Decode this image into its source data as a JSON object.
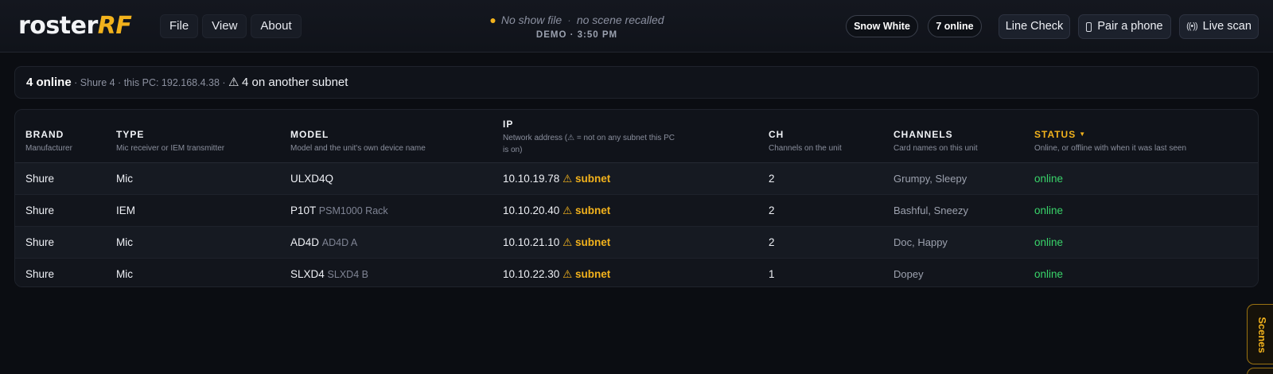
{
  "app": {
    "logo_part1": "roster",
    "logo_part2": "RF",
    "menu": [
      "File",
      "View",
      "About"
    ],
    "show_file": "No show file",
    "scene_status": "no scene recalled",
    "sub_status": "DEMO · 3:50 PM",
    "user_pill": "Snow White",
    "online_pill": "7 online",
    "buttons": {
      "line_check": "Line Check",
      "pair_phone": "Pair a phone",
      "live_scan": "Live scan"
    }
  },
  "summary": {
    "online": "4 online",
    "detail": "· Shure 4 · this PC: 192.168.4.38 ·",
    "warning": "4 on another subnet"
  },
  "table": {
    "columns": [
      {
        "title": "BRAND",
        "sub": "Manufacturer"
      },
      {
        "title": "TYPE",
        "sub": "Mic receiver or IEM transmitter"
      },
      {
        "title": "MODEL",
        "sub": "Model and the unit's own device name"
      },
      {
        "title": "IP",
        "sub": "Network address (⚠ = not on any subnet this PC is on)"
      },
      {
        "title": "CH",
        "sub": "Channels on the unit"
      },
      {
        "title": "CHANNELS",
        "sub": "Card names on this unit"
      },
      {
        "title": "STATUS",
        "sub": "Online, or offline with when it was last seen"
      }
    ],
    "rows": [
      {
        "brand": "Shure",
        "type": "Mic",
        "model": "ULXD4Q",
        "device": "",
        "ip": "10.10.19.78",
        "ip_flag": "subnet",
        "ch": "2",
        "channels": "Grumpy, Sleepy",
        "status": "online"
      },
      {
        "brand": "Shure",
        "type": "IEM",
        "model": "P10T",
        "device": "PSM1000 Rack",
        "ip": "10.10.20.40",
        "ip_flag": "subnet",
        "ch": "2",
        "channels": "Bashful, Sneezy",
        "status": "online"
      },
      {
        "brand": "Shure",
        "type": "Mic",
        "model": "AD4D",
        "device": "AD4D A",
        "ip": "10.10.21.10",
        "ip_flag": "subnet",
        "ch": "2",
        "channels": "Doc, Happy",
        "status": "online"
      },
      {
        "brand": "Shure",
        "type": "Mic",
        "model": "SLXD4",
        "device": "SLXD4 B",
        "ip": "10.10.22.30",
        "ip_flag": "subnet",
        "ch": "1",
        "channels": "Dopey",
        "status": "online"
      }
    ]
  },
  "side_tab": {
    "label": "Scenes"
  },
  "colors": {
    "accent": "#f2b21c",
    "online": "#39d46a",
    "background": "#0b0d12"
  },
  "icons": {
    "warning": "warning-icon",
    "phone": "phone-icon",
    "scan": "broadcast-icon",
    "sort": "sort-desc-icon"
  }
}
